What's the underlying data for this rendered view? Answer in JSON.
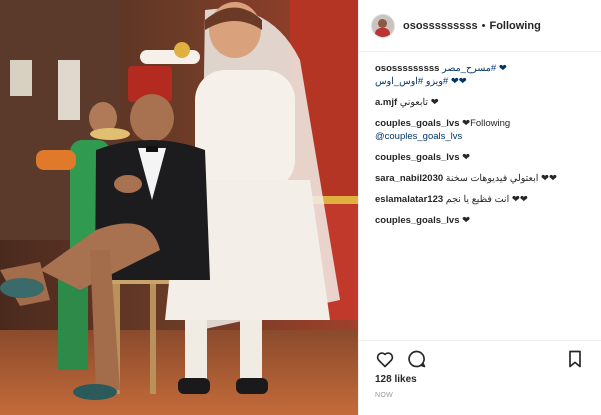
{
  "header": {
    "username": "ososssssssss",
    "separator": "•",
    "follow_label": "Following"
  },
  "caption": {
    "username": "ososssssssss",
    "line1": "مسرح_مصر# ❤",
    "line2": "ويزو #اوس_اوس# ❤❤"
  },
  "comments": [
    {
      "user": "a.mjf",
      "text": "تابعوني ❤"
    },
    {
      "user": "couples_goals_lvs",
      "text": "❤Following",
      "mention": "@couples_goals_lvs"
    },
    {
      "user": "couples_goals_lvs",
      "text": "❤"
    },
    {
      "user": "sara_nabil2030",
      "text": "ابعتولي فيديوهات سخنة ❤❤"
    },
    {
      "user": "eslamalatar123",
      "text": "انت فظيع يا نجم ❤❤"
    },
    {
      "user": "couples_goals_lvs",
      "text": "❤"
    }
  ],
  "actions": {
    "like_icon": "heart-icon",
    "comment_icon": "comment-icon",
    "save_icon": "bookmark-icon"
  },
  "likes": "128 likes",
  "timestamp": "NOW"
}
